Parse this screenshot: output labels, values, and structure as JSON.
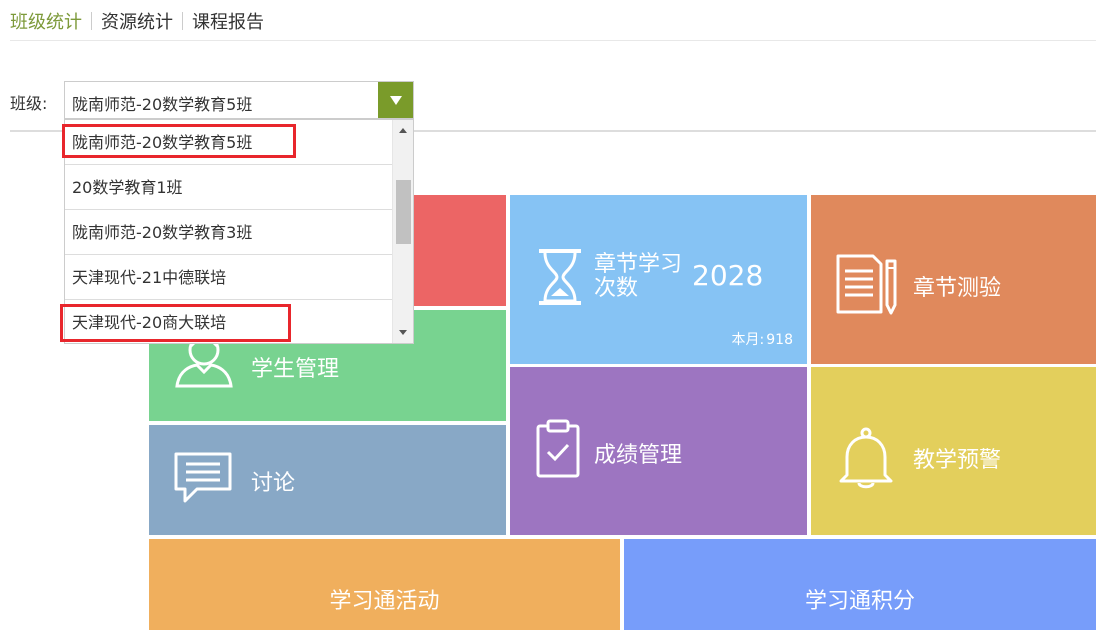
{
  "tabs": [
    {
      "label": "班级统计",
      "active": true
    },
    {
      "label": "资源统计",
      "active": false
    },
    {
      "label": "课程报告",
      "active": false
    }
  ],
  "class_selector": {
    "label": "班级:",
    "selected": "陇南师范-20数学教育5班"
  },
  "dropdown_options": [
    "陇南师范-20数学教育5班",
    "20数学教育1班",
    "陇南师范-20数学教育3班",
    "天津现代-21中德联培",
    "天津现代-20商大联培"
  ],
  "highlighted_options": [
    0,
    4
  ],
  "tiles": {
    "student_management": {
      "title": "学生管理",
      "icon": "student-icon"
    },
    "discussion": {
      "title": "讨论",
      "icon": "chat-icon"
    },
    "chapter_study": {
      "title_line1": "章节学习",
      "title_line2": "次数",
      "count": "2028",
      "month_label": "本月:",
      "month_value": "918",
      "icon": "hourglass-icon"
    },
    "chapter_quiz": {
      "title": "章节测验",
      "icon": "quiz-icon"
    },
    "grade_management": {
      "title": "成绩管理",
      "icon": "clipboard-icon"
    },
    "teaching_warning": {
      "title": "教学预警",
      "icon": "bell-icon"
    },
    "xxt_activity": {
      "title": "学习通活动"
    },
    "xxt_points": {
      "title": "学习通积分"
    }
  },
  "colors": {
    "accent": "#7a9b2a",
    "red": "#ec6565",
    "green": "#78d390",
    "steel": "#88a8c6",
    "sky": "#86c3f4",
    "orange": "#e0895c",
    "purple": "#9d75c1",
    "yellow": "#e3cf5c",
    "peach": "#f0af5d",
    "blue": "#779dfa",
    "highlight": "#e8262c"
  }
}
